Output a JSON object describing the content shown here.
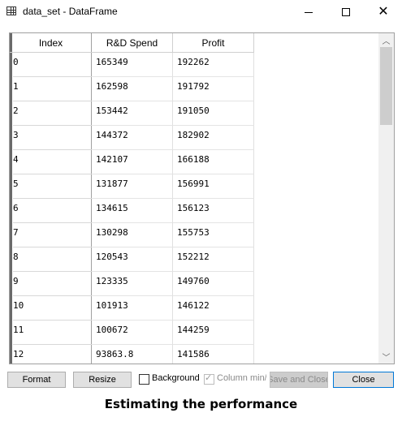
{
  "window": {
    "title": "data_set - DataFrame",
    "icon": "table-icon",
    "minimize_icon": "minimize-icon",
    "maximize_icon": "maximize-icon",
    "close_icon": "close-icon"
  },
  "table": {
    "columns": [
      "Index",
      "R&D Spend",
      "Profit"
    ],
    "rows": [
      {
        "index": "0",
        "rd": "165349",
        "profit": "192262"
      },
      {
        "index": "1",
        "rd": "162598",
        "profit": "191792"
      },
      {
        "index": "2",
        "rd": "153442",
        "profit": "191050"
      },
      {
        "index": "3",
        "rd": "144372",
        "profit": "182902"
      },
      {
        "index": "4",
        "rd": "142107",
        "profit": "166188"
      },
      {
        "index": "5",
        "rd": "131877",
        "profit": "156991"
      },
      {
        "index": "6",
        "rd": "134615",
        "profit": "156123"
      },
      {
        "index": "7",
        "rd": "130298",
        "profit": "155753"
      },
      {
        "index": "8",
        "rd": "120543",
        "profit": "152212"
      },
      {
        "index": "9",
        "rd": "123335",
        "profit": "149760"
      },
      {
        "index": "10",
        "rd": "101913",
        "profit": "146122"
      },
      {
        "index": "11",
        "rd": "100672",
        "profit": "144259"
      },
      {
        "index": "12",
        "rd": "93863.8",
        "profit": "141586"
      }
    ]
  },
  "scrollbar": {
    "up_icon": "chevron-up-icon",
    "down_icon": "chevron-down-icon"
  },
  "toolbar": {
    "format_label": "Format",
    "resize_label": "Resize",
    "background_label": "Background",
    "background_checked": false,
    "column_min_label": "Column min/max",
    "column_min_checked": true,
    "save_close_label": "Save and Close",
    "close_label": "Close"
  },
  "caption": "Estimating the performance",
  "colors": {
    "close_button_border": "#0078d7",
    "disabled_text": "#8a8a8a"
  }
}
